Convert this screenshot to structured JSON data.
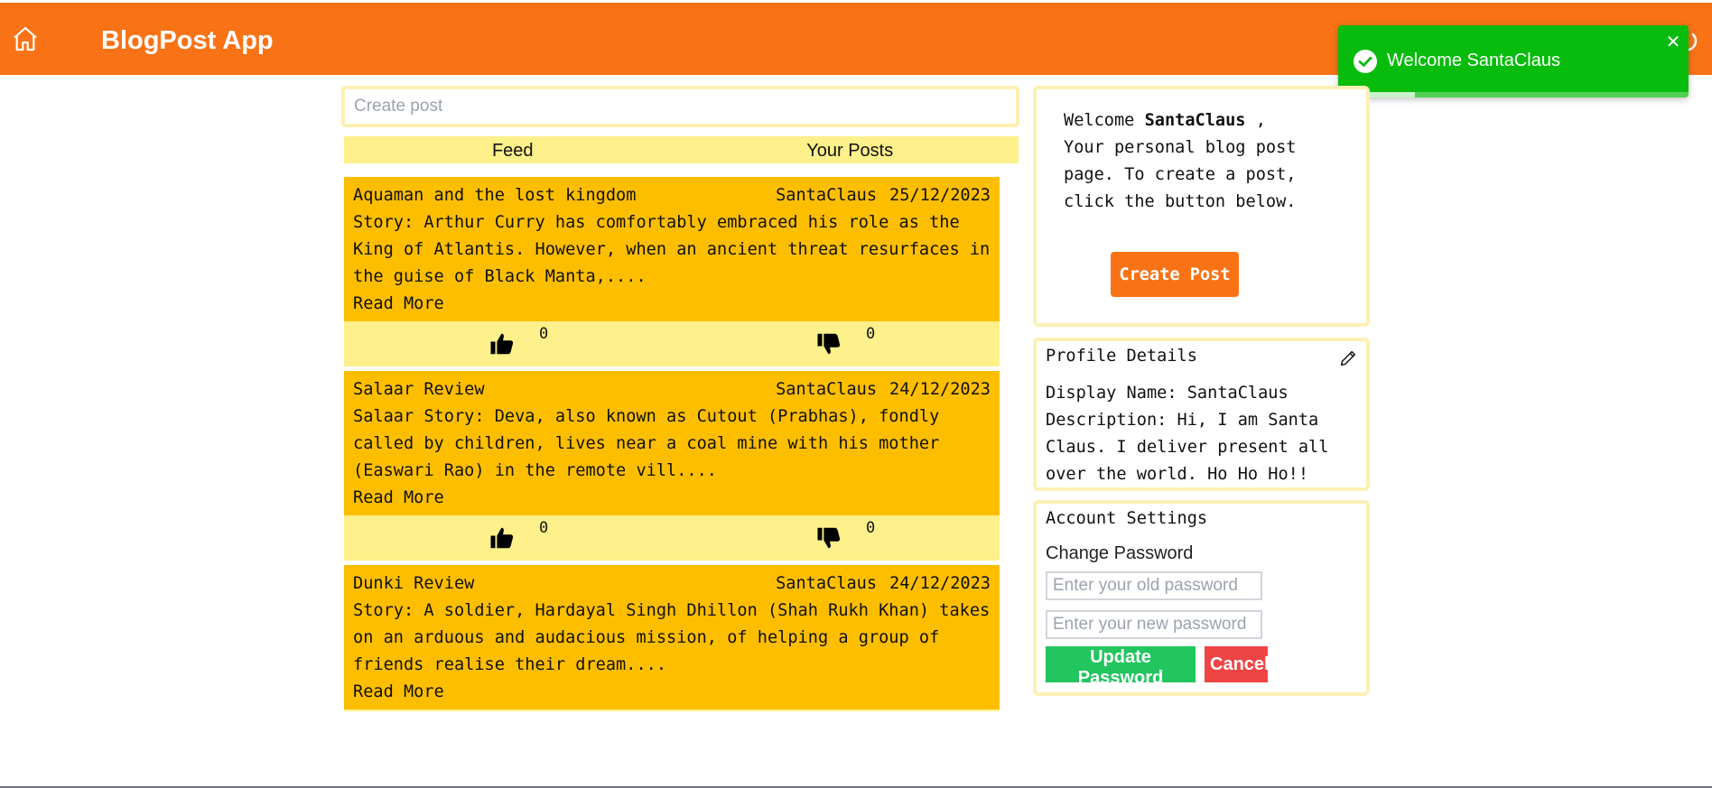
{
  "header": {
    "title": "BlogPost App",
    "home_icon": "home-icon",
    "power_icon": "power-icon",
    "background": "#f97316"
  },
  "toast": {
    "message": "Welcome SantaClaus",
    "close_label": "✕",
    "progress": 0.22,
    "background": "#07bc0c"
  },
  "create_input": {
    "placeholder": "Create post",
    "value": ""
  },
  "tabs": [
    {
      "label": "Feed"
    },
    {
      "label": "Your Posts"
    }
  ],
  "posts": [
    {
      "title": "Aquaman and the lost kingdom",
      "author": "SantaClaus",
      "date": "25/12/2023",
      "lines": [
        "Story: Arthur Curry has comfortably embraced his role as the",
        "King of Atlantis. However, when an ancient threat resurfaces in",
        "the guise of Black Manta,...."
      ],
      "read_more": "Read More",
      "likes": "0",
      "dislikes": "0"
    },
    {
      "title": "Salaar Review",
      "author": "SantaClaus",
      "date": "24/12/2023",
      "lines": [
        "Salaar Story: Deva, also known as Cutout (Prabhas), fondly",
        "called by children, lives near a coal mine with his mother",
        "(Easwari Rao) in the remote vill...."
      ],
      "read_more": "Read More",
      "likes": "0",
      "dislikes": "0"
    },
    {
      "title": "Dunki Review",
      "author": "SantaClaus",
      "date": "24/12/2023",
      "lines": [
        "Story: A soldier, Hardayal Singh Dhillon (Shah Rukh Khan) takes",
        "on an arduous and audacious mission, of helping a group of",
        "friends realise their dream...."
      ],
      "read_more": "Read More",
      "likes": "0",
      "dislikes": "0"
    }
  ],
  "welcome": {
    "prefix": "Welcome ",
    "username": "SantaClaus",
    "suffix": " ,",
    "body": "Your personal blog post page. To create a post, click the button below.",
    "button_label": "Create Post"
  },
  "profile": {
    "title": "Profile Details",
    "display_name_label": "Display Name: ",
    "display_name": "SantaClaus",
    "description_label": "Description: ",
    "description": "Hi, I am Santa Claus. I deliver present all over the world. Ho Ho Ho!!"
  },
  "account": {
    "title": "Account Settings",
    "change_password_label": "Change Password",
    "old_password_placeholder": "Enter your old password",
    "new_password_placeholder": "Enter your new password",
    "update_label": "Update Password",
    "cancel_label": "Cancel"
  },
  "colors": {
    "accent_orange": "#f97316",
    "post_yellow": "#fdbe00",
    "light_yellow": "#fef08a",
    "success_green": "#22c55e",
    "danger_red": "#ef4444"
  }
}
